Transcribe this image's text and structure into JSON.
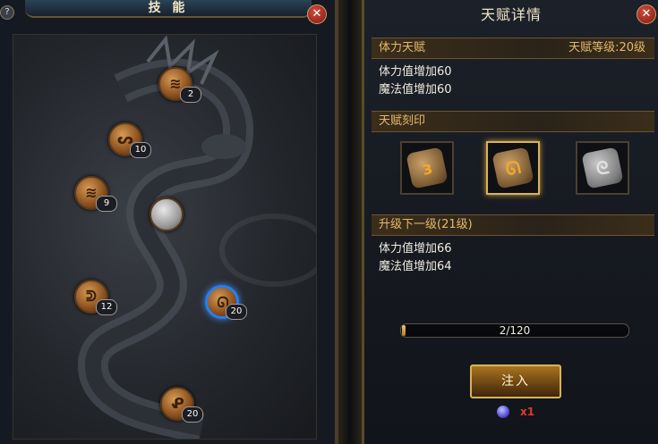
{
  "left_panel": {
    "title": "技 能",
    "help_icon": "?",
    "close_icon": "close-icon",
    "nodes": [
      {
        "glyph": "≋",
        "level": "2",
        "state": "normal"
      },
      {
        "glyph": "ᔕ",
        "level": "10",
        "state": "normal"
      },
      {
        "glyph": "≋",
        "level": "9",
        "state": "normal"
      },
      {
        "glyph": "",
        "level": "",
        "state": "locked"
      },
      {
        "glyph": "ᕲ",
        "level": "12",
        "state": "normal"
      },
      {
        "glyph": "ᘏ",
        "level": "20",
        "state": "selected"
      },
      {
        "glyph": "ᕵ",
        "level": "20",
        "state": "normal"
      }
    ]
  },
  "right_panel": {
    "title": "天赋详情",
    "close_icon": "close-icon",
    "talent": {
      "name": "体力天赋",
      "level_text": "天赋等级:20级",
      "current_effects": [
        "体力值增加60",
        "魔法值增加60"
      ]
    },
    "engraving": {
      "label": "天赋刻印",
      "runes": [
        {
          "glyph": "ɜ",
          "material": "bronze",
          "active": false
        },
        {
          "glyph": "ᘏ",
          "material": "bronze",
          "active": true
        },
        {
          "glyph": "ᘓ",
          "material": "stone",
          "active": false
        }
      ]
    },
    "next_level": {
      "label": "升级下一级(21级)",
      "effects": [
        "体力值增加66",
        "魔法值增加64"
      ]
    },
    "progress": {
      "current": 2,
      "max": 120,
      "text": "2/120",
      "fraction": 0.0167
    },
    "inject_button": "注入",
    "cost": {
      "icon": "orb-icon",
      "count": "x1"
    },
    "colors": {
      "accent": "#e6b86a",
      "cost": "#e23a2a",
      "selected_ring": "#2a7ee8"
    }
  }
}
